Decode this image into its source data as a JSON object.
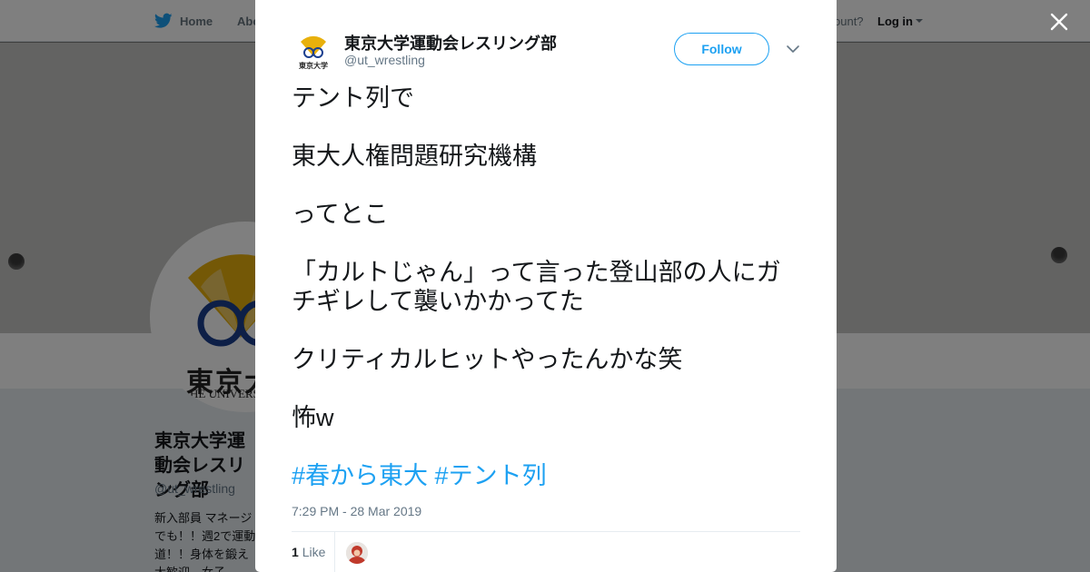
{
  "nav": {
    "home_label": "Home",
    "about_label": "Abo",
    "account_text": "ccount?",
    "login_label": "Log in"
  },
  "background_profile": {
    "name": "東京大学運動会レスリング部",
    "handle": "@ut_wrestling",
    "bio": "新入部員 マネージ\nでも！！週2で運動\n道！！身体を鍛え\n大歓迎。女子",
    "avatar_text": "東京大",
    "avatar_subtext": "HE UNIVERSITY"
  },
  "tweet": {
    "author_name": "東京大学運動会レスリング部",
    "author_handle": "@ut_wrestling",
    "avatar_text": "東京大学",
    "follow_label": "Follow",
    "paragraphs": [
      "テント列で",
      "東大人権問題研究機構",
      "ってとこ",
      "「カルトじゃん」って言った登山部の人にガチギレして襲いかかってた",
      "クリティカルヒットやったんかな笑",
      "怖w"
    ],
    "hashtags": [
      "#春から東大",
      "#テント列"
    ],
    "timestamp": "7:29 PM - 28 Mar 2019",
    "like_count": "1",
    "like_label": "Like"
  },
  "colors": {
    "twitter_blue": "#1da1f2",
    "text_primary": "#14171a",
    "text_secondary": "#657786",
    "ginkgo_yellow": "#e8b00c",
    "ginkgo_blue": "#1b3f8f"
  },
  "icons": {
    "nav_home": "twitter-bird-icon",
    "close": "close-icon",
    "caret": "chevron-down-icon"
  }
}
